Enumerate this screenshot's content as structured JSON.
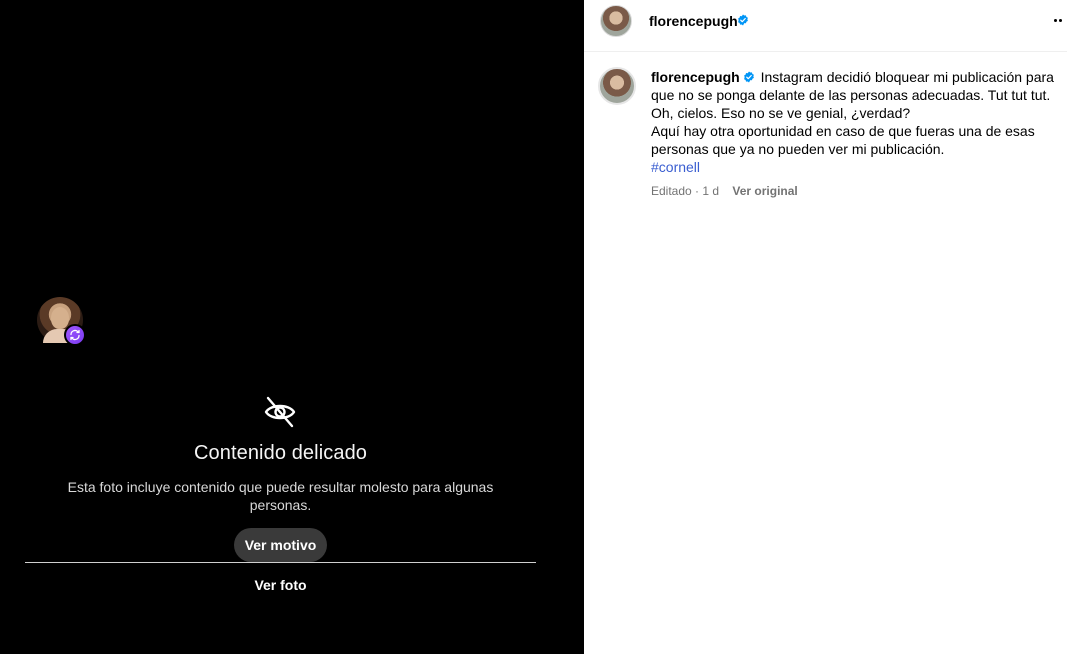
{
  "media": {
    "overlay_title": "Contenido delicado",
    "overlay_description": "Esta foto incluye contenido que puede resultar molesto para algunas personas.",
    "see_reason_button": "Ver motivo",
    "see_photo_button": "Ver foto",
    "icons": {
      "repost": "repost-icon",
      "sensitive": "eye-slash-icon"
    }
  },
  "header": {
    "username": "florencepugh",
    "verified": true,
    "more_icon": "more-horizontal-icon"
  },
  "caption": {
    "username": "florencepugh",
    "line1": "Instagram decidió bloquear mi publicación para que no se ponga delante de las personas adecuadas. Tut tut tut.",
    "line2": "Oh, cielos. Eso no se ve genial, ¿verdad?",
    "line3": "Aquí hay otra oportunidad en caso de que fueras una de esas personas que ya no pueden ver mi publicación.",
    "hashtag": "#cornell"
  },
  "meta": {
    "edited_time": "Editado · 1 d",
    "view_original": "Ver original"
  },
  "colors": {
    "verified_blue": "#0095f6",
    "hashtag_blue": "#3a5ed0",
    "repost_purple": "#8b46f5"
  }
}
